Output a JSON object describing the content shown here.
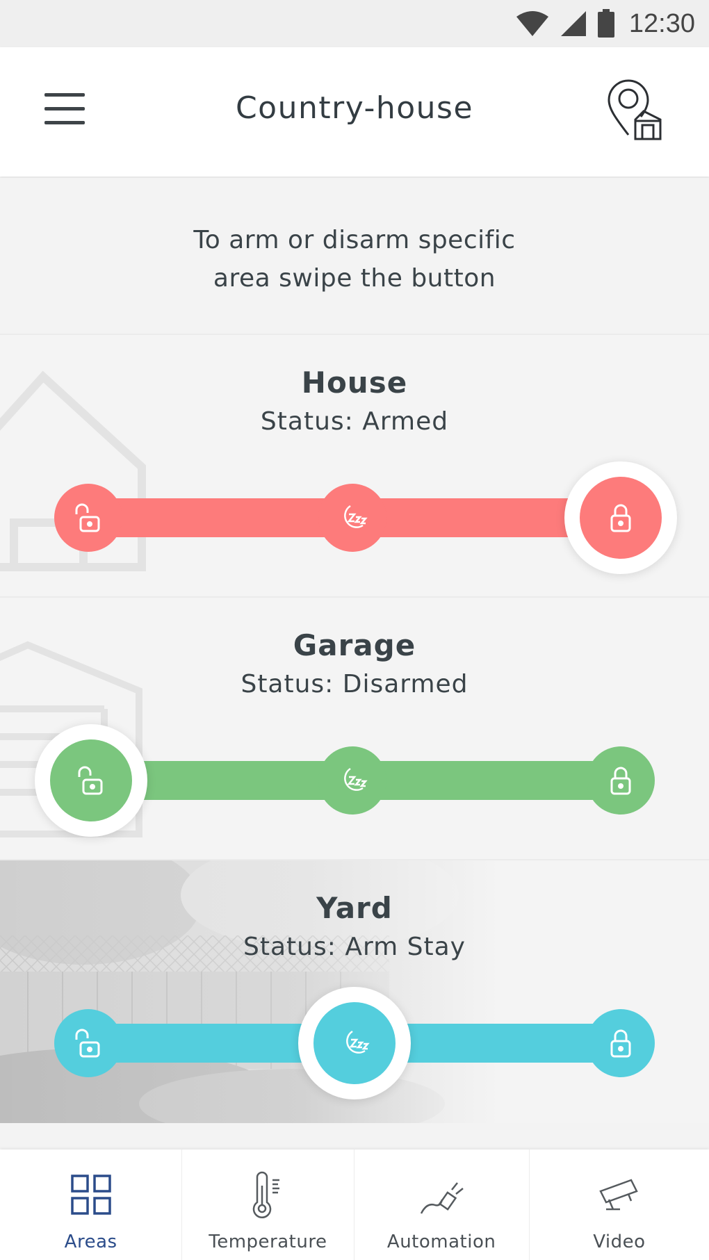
{
  "status_bar": {
    "time": "12:30"
  },
  "app_bar": {
    "title": "Country-house"
  },
  "hint": {
    "line1": "To arm or disarm specific",
    "line2": "area swipe the button"
  },
  "areas": [
    {
      "name": "House",
      "status": "Status: Armed",
      "color": "#fd7b7b",
      "state": "armed",
      "icon": "house-outline"
    },
    {
      "name": "Garage",
      "status": "Status: Disarmed",
      "color": "#7bc67e",
      "state": "disarmed",
      "icon": "garage-outline"
    },
    {
      "name": "Yard",
      "status": "Status: Arm Stay",
      "color": "#54cedd",
      "state": "stay",
      "icon": "yard-photo"
    }
  ],
  "bottom_nav": {
    "active_color": "#2b4c8a",
    "items": [
      {
        "label": "Areas",
        "icon": "grid-icon",
        "active": true
      },
      {
        "label": "Temperature",
        "icon": "thermometer-icon",
        "active": false
      },
      {
        "label": "Automation",
        "icon": "plug-icon",
        "active": false
      },
      {
        "label": "Video",
        "icon": "camera-icon",
        "active": false
      }
    ]
  }
}
